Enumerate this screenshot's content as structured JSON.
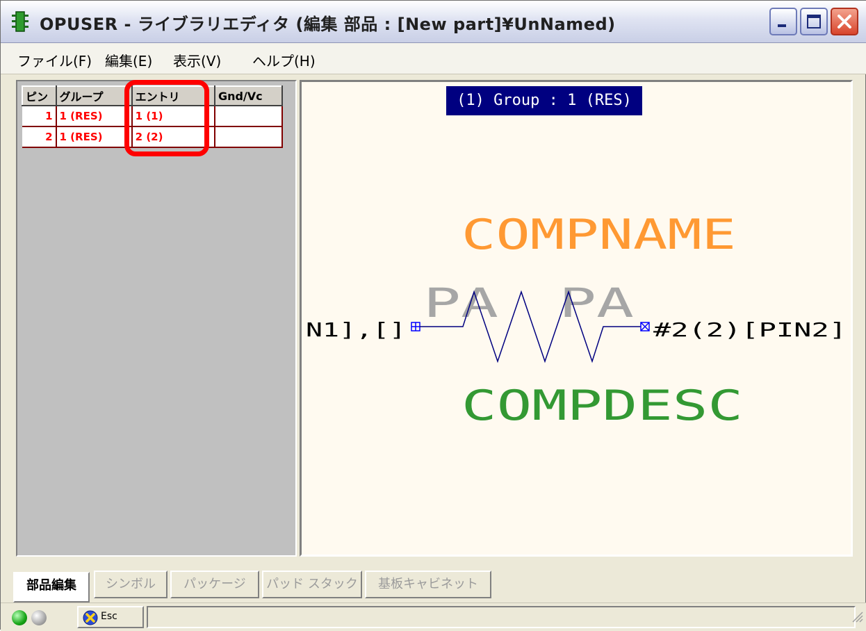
{
  "window": {
    "title": "OPUSER - ライブラリエディタ (編集 部品 : [New part]¥UnNamed)"
  },
  "menu": [
    "ファイル(F)",
    "編集(E)",
    "表示(V)",
    "ヘルプ(H)"
  ],
  "table": {
    "headers": [
      "ピン",
      "グループ",
      "エントリ",
      "Gnd/Vc"
    ],
    "rows": [
      [
        "1",
        "1 (RES)",
        "1 (1)",
        ""
      ],
      [
        "2",
        "1 (RES)",
        "2 (2)",
        ""
      ]
    ]
  },
  "canvas": {
    "group_label": "(1) Group : 1 (RES)",
    "compname": "COMPNAME",
    "compdesc": "COMPDESC",
    "pa_left": "PA",
    "pa_right": "PA",
    "pin_left_text": "N1],[]",
    "pin_right_text": "#2(2)[PIN2]",
    "colors": {
      "compname": "#ff9933",
      "compdesc": "#339933",
      "pa": "#a6a6a6",
      "symbol": "#000080",
      "pin_text": "#000000"
    }
  },
  "tabs": [
    "部品編集",
    "シンボル",
    "パッケージ",
    "パッド スタック",
    "基板キャビネット"
  ],
  "status": {
    "esc_label": "Esc"
  },
  "icons": [
    "app-icon",
    "minimize-icon",
    "maximize-icon",
    "close-icon",
    "esc-icon",
    "resize-grip-icon"
  ]
}
